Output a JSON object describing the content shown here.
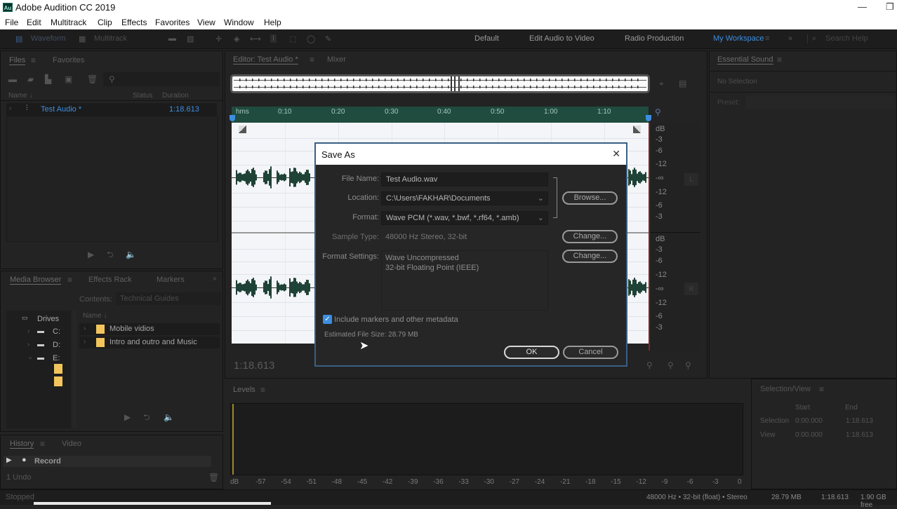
{
  "app": {
    "title": "Adobe Audition CC 2019",
    "logo": "Au",
    "minimize": "—",
    "restore": "❐"
  },
  "menu": [
    "File",
    "Edit",
    "Multitrack",
    "Clip",
    "Effects",
    "Favorites",
    "View",
    "Window",
    "Help"
  ],
  "toolbar": {
    "waveform_label": "Waveform",
    "multitrack_label": "Multitrack",
    "workspaces": [
      "Default",
      "Edit Audio to Video",
      "Radio Production",
      "My Workspace"
    ],
    "active_workspace": "My Workspace",
    "more": "»",
    "search_placeholder": "Search Help"
  },
  "files_panel": {
    "tabs": [
      "Files",
      "Favorites"
    ],
    "columns": [
      "Name ↓",
      "Status",
      "Duration"
    ],
    "rows": [
      {
        "name": "Test Audio *",
        "status": "",
        "duration": "1:18.613"
      }
    ]
  },
  "media_browser": {
    "tabs": [
      "Media Browser",
      "Effects Rack",
      "Markers"
    ],
    "contents_label": "Contents:",
    "contents_value": "Technical Guides",
    "drives_label": "Drives",
    "drives": [
      "C:",
      "D:",
      "E:"
    ],
    "column_name": "Name ↓",
    "items": [
      "Mobile vidios",
      "Intro and outro and Music"
    ]
  },
  "history_panel": {
    "tabs": [
      "History",
      "Video"
    ],
    "record_label": "Record",
    "undo_count": "1 Undo",
    "status": "Stopped"
  },
  "editor": {
    "tabs": [
      "Editor: Test Audio *",
      "Mixer"
    ],
    "ruler_labels": [
      "hms",
      "0:10",
      "0:20",
      "0:30",
      "0:40",
      "0:50",
      "1:00",
      "1:10"
    ],
    "db_top": [
      "dB",
      "-3",
      "-6",
      "-12",
      "-∞",
      "-12",
      "-6",
      "-3"
    ],
    "db_bottom": [
      "dB",
      "-3",
      "-6",
      "-12",
      "-∞",
      "-12",
      "-6",
      "-3"
    ],
    "channel_left": "L",
    "channel_right": "R",
    "time_display": "1:18.613"
  },
  "essential_sound": {
    "title": "Essential Sound",
    "status": "No Selection",
    "preset_label": "Preset:"
  },
  "dialog": {
    "title": "Save As",
    "close": "✕",
    "file_name_label": "File Name:",
    "file_name_value": "Test Audio.wav",
    "location_label": "Location:",
    "location_value": "C:\\Users\\FAKHAR\\Documents",
    "format_label": "Format:",
    "format_value": "Wave PCM (*.wav, *.bwf, *.rf64, *.amb)",
    "sample_type_label": "Sample Type:",
    "sample_type_value": "48000 Hz Stereo, 32-bit",
    "format_settings_label": "Format Settings:",
    "format_settings_line1": "Wave Uncompressed",
    "format_settings_line2": "32-bit Floating Point (IEEE)",
    "browse_label": "Browse...",
    "change_label": "Change...",
    "include_metadata_label": "Include markers and other metadata",
    "include_metadata_checked": true,
    "estimated_size": "Estimated File Size: 28.79 MB",
    "ok_label": "OK",
    "cancel_label": "Cancel"
  },
  "levels": {
    "title": "Levels",
    "ticks": [
      "dB",
      "-57",
      "-54",
      "-51",
      "-48",
      "-45",
      "-42",
      "-39",
      "-36",
      "-33",
      "-30",
      "-27",
      "-24",
      "-21",
      "-18",
      "-15",
      "-12",
      "-9",
      "-6",
      "-3",
      "0"
    ]
  },
  "selection_view": {
    "title": "Selection/View",
    "columns": [
      "Start",
      "End"
    ],
    "rows": [
      {
        "label": "Selection",
        "start": "0:00.000",
        "end": "1:18.613"
      },
      {
        "label": "View",
        "start": "0:00.000",
        "end": "1:18.613"
      }
    ]
  },
  "statusbar": {
    "format": "48000 Hz • 32-bit (float) • Stereo",
    "size": "28.79 MB",
    "duration": "1:18.613",
    "free": "1.90 GB free"
  },
  "colors": {
    "accent": "#3d8ee0",
    "ruler": "#1f4c3f",
    "waveform": "#1f4236",
    "dialog_border": "#3a5f86"
  }
}
